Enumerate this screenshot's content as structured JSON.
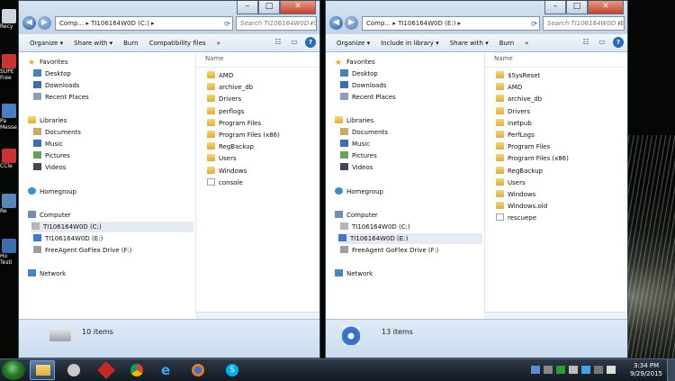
{
  "desktop_icons": [
    "Recy",
    "SUPE Free",
    "Pa Messe",
    "CCle",
    "Re",
    "Ho Testi"
  ],
  "window_left": {
    "address": "Comp... ▸ TI106164W0D (C:) ▸",
    "search_placeholder": "Search TI106164W0D (C:)",
    "toolbar": [
      "Organize ▾",
      "Share with ▾",
      "Burn",
      "Compatibility files",
      "»"
    ],
    "nav": {
      "favorites": "Favorites",
      "favorites_items": [
        "Desktop",
        "Downloads",
        "Recent Places"
      ],
      "libraries": "Libraries",
      "libraries_items": [
        "Documents",
        "Music",
        "Pictures",
        "Videos"
      ],
      "homegroup": "Homegroup",
      "computer": "Computer",
      "computer_items": [
        "TI106164W0D (C:)",
        "TI106164W0D (E:)",
        "FreeAgent GoFlex Drive (F:)"
      ],
      "network": "Network"
    },
    "column_name": "Name",
    "files": [
      {
        "name": "AMD",
        "type": "folder"
      },
      {
        "name": "archive_db",
        "type": "folder"
      },
      {
        "name": "Drivers",
        "type": "folder"
      },
      {
        "name": "perflogs",
        "type": "folder"
      },
      {
        "name": "Program Files",
        "type": "folder"
      },
      {
        "name": "Program Files (x86)",
        "type": "folder"
      },
      {
        "name": "RegBackup",
        "type": "folder"
      },
      {
        "name": "Users",
        "type": "folder"
      },
      {
        "name": "Windows",
        "type": "folder"
      },
      {
        "name": "console",
        "type": "file"
      }
    ],
    "status": "10 items"
  },
  "window_right": {
    "address": "Comp... ▸ TI106164W0D (E:) ▸",
    "search_placeholder": "Search TI106164W0D (E:)",
    "toolbar": [
      "Organize ▾",
      "Include in library ▾",
      "Share with ▾",
      "Burn",
      "»"
    ],
    "nav": {
      "favorites": "Favorites",
      "favorites_items": [
        "Desktop",
        "Downloads",
        "Recent Places"
      ],
      "libraries": "Libraries",
      "libraries_items": [
        "Documents",
        "Music",
        "Pictures",
        "Videos"
      ],
      "homegroup": "Homegroup",
      "computer": "Computer",
      "computer_items": [
        "TI106164W0D (C:)",
        "TI106164W0D (E:)",
        "FreeAgent GoFlex Drive (F:)"
      ],
      "network": "Network"
    },
    "column_name": "Name",
    "files": [
      {
        "name": "$SysReset",
        "type": "folder"
      },
      {
        "name": "AMD",
        "type": "folder"
      },
      {
        "name": "archive_db",
        "type": "folder"
      },
      {
        "name": "Drivers",
        "type": "folder"
      },
      {
        "name": "inetpub",
        "type": "folder"
      },
      {
        "name": "PerfLogs",
        "type": "folder"
      },
      {
        "name": "Program Files",
        "type": "folder"
      },
      {
        "name": "Program Files (x86)",
        "type": "folder"
      },
      {
        "name": "RegBackup",
        "type": "folder"
      },
      {
        "name": "Users",
        "type": "folder"
      },
      {
        "name": "Windows",
        "type": "folder"
      },
      {
        "name": "Windows.old",
        "type": "folder"
      },
      {
        "name": "rescuepe",
        "type": "file"
      }
    ],
    "status": "13 items"
  },
  "taskbar": {
    "time": "3:34 PM",
    "date": "9/29/2015"
  }
}
